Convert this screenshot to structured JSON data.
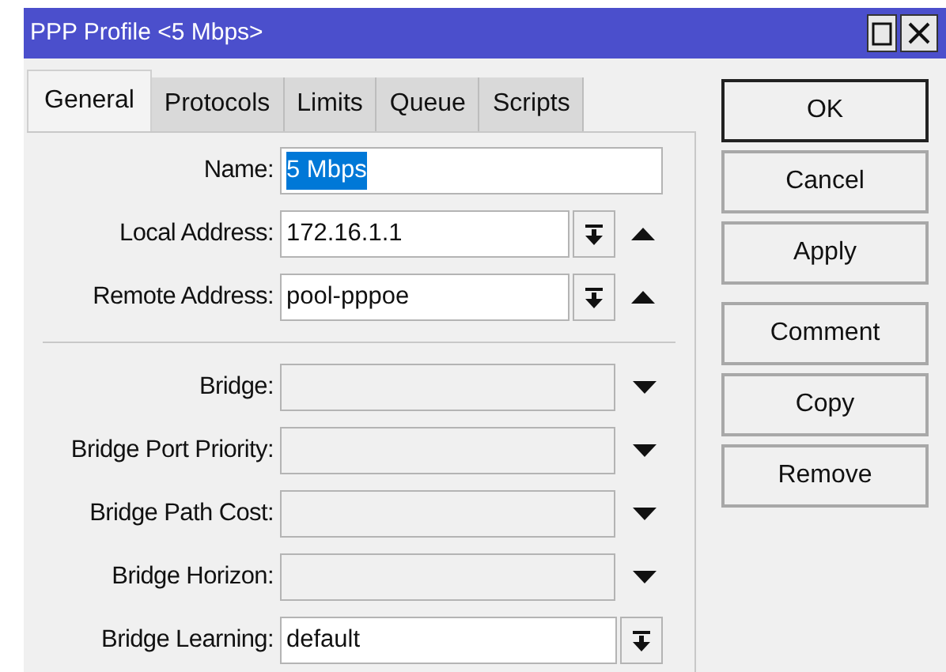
{
  "window": {
    "title": "PPP Profile <5 Mbps>"
  },
  "tabs": [
    {
      "label": "General",
      "selected": true
    },
    {
      "label": "Protocols",
      "selected": false
    },
    {
      "label": "Limits",
      "selected": false
    },
    {
      "label": "Queue",
      "selected": false
    },
    {
      "label": "Scripts",
      "selected": false
    }
  ],
  "fields": [
    {
      "kind": "text",
      "label": "Name:",
      "value": "5 Mbps",
      "text_selected": true,
      "disabled": false
    },
    {
      "kind": "combo",
      "label": "Local Address:",
      "value": "172.16.1.1",
      "disabled": false
    },
    {
      "kind": "combo",
      "label": "Remote Address:",
      "value": "pool-pppoe",
      "disabled": false
    },
    {
      "kind": "separator"
    },
    {
      "kind": "dropdown",
      "label": "Bridge:",
      "disabled": true
    },
    {
      "kind": "dropdown",
      "label": "Bridge Port Priority:",
      "disabled": true
    },
    {
      "kind": "dropdown",
      "label": "Bridge Path Cost:",
      "disabled": true
    },
    {
      "kind": "dropdown",
      "label": "Bridge Horizon:",
      "disabled": true
    },
    {
      "kind": "select",
      "label": "Bridge Learning:",
      "value": "default",
      "disabled": false
    }
  ],
  "buttons": [
    {
      "label": "OK",
      "default": true
    },
    {
      "label": "Cancel",
      "default": false
    },
    {
      "label": "Apply",
      "default": false
    },
    {
      "label": "Comment",
      "default": false,
      "gap_before": true
    },
    {
      "label": "Copy",
      "default": false
    },
    {
      "label": "Remove",
      "default": false
    }
  ]
}
